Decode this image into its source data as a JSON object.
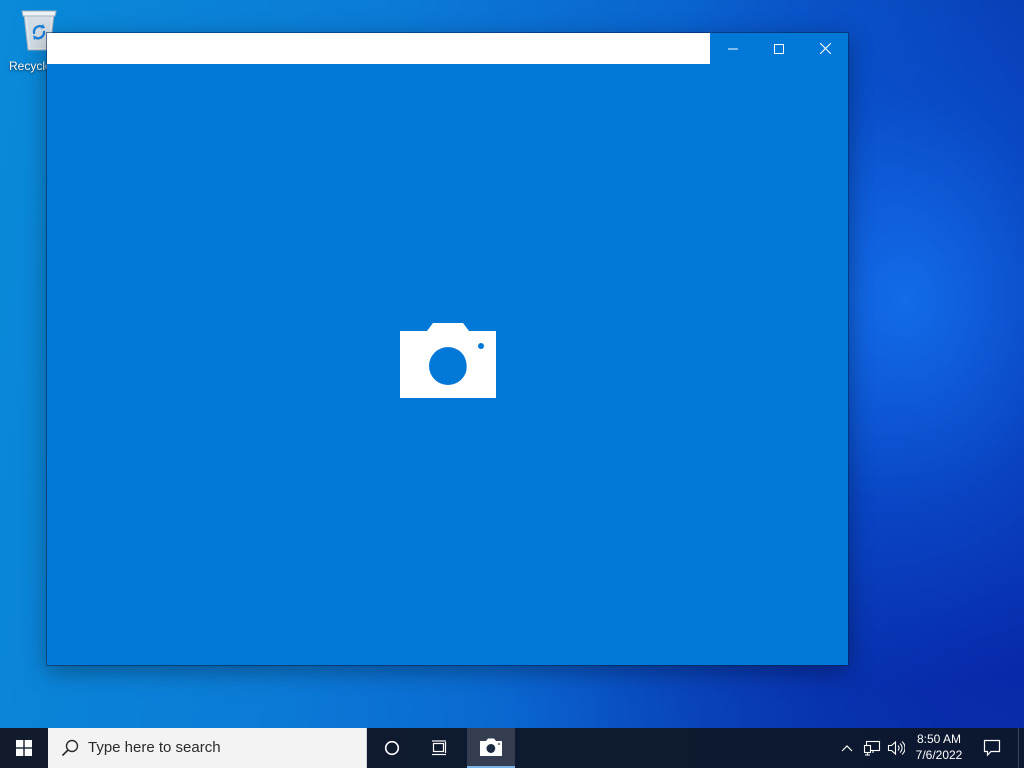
{
  "desktop": {
    "icons": [
      {
        "label": "Recycle Bin",
        "icon": "recycle-bin-icon"
      }
    ]
  },
  "window": {
    "app": "Camera",
    "center_icon": "camera-icon",
    "caption_buttons": [
      "minimize-icon",
      "maximize-icon",
      "close-icon"
    ]
  },
  "taskbar": {
    "start_icon": "windows-logo-icon",
    "search": {
      "placeholder": "Type here to search",
      "icon": "search-icon"
    },
    "pinned": [
      {
        "icon": "cortana-icon"
      },
      {
        "icon": "task-view-icon"
      },
      {
        "icon": "camera-app-icon",
        "active": true
      }
    ],
    "tray": {
      "icons": [
        "show-hidden-icons-chevron",
        "network-icon",
        "volume-icon"
      ],
      "time": "8:50 AM",
      "date": "7/6/2022",
      "notification_icon": "action-center-icon"
    }
  },
  "colors": {
    "accent": "#0078d7",
    "taskbar": "#111b2b",
    "search_bg": "#f3f3f3"
  }
}
